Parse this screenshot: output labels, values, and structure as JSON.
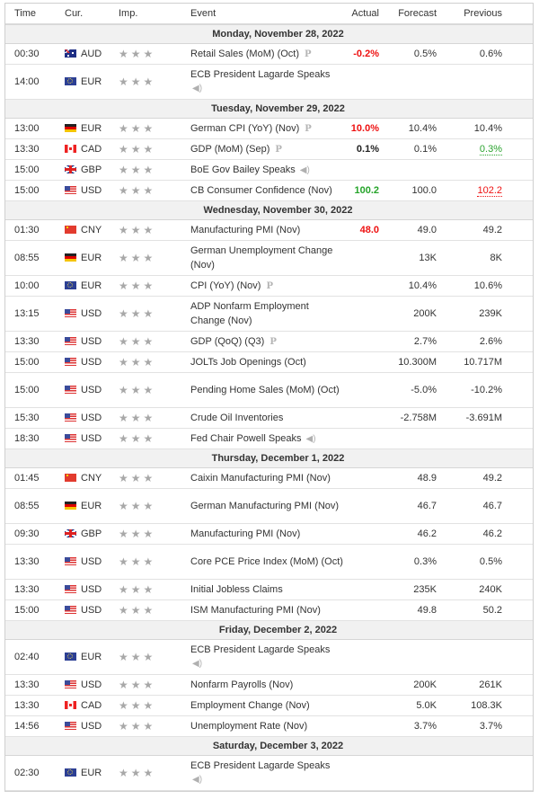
{
  "columns": {
    "time": "Time",
    "currency": "Cur.",
    "importance": "Imp.",
    "event": "Event",
    "actual": "Actual",
    "forecast": "Forecast",
    "previous": "Previous"
  },
  "importance_stars": "★★★",
  "colors": {
    "negative": "#ee1111",
    "positive": "#25a42a",
    "day_header_bg": "#f1f1f1",
    "star": "#a8a8a8"
  },
  "days": [
    {
      "label": "Monday, November 28, 2022",
      "events": [
        {
          "time": "00:30",
          "flag": "au",
          "currency": "AUD",
          "event": "Retail Sales (MoM) (Oct)",
          "marker": "P",
          "actual": "-0.2%",
          "actual_color": "red",
          "forecast": "0.5%",
          "previous": "0.6%"
        },
        {
          "time": "14:00",
          "flag": "eu",
          "currency": "EUR",
          "event": "ECB President Lagarde Speaks",
          "speaker": "speaker-icon",
          "tall": true,
          "actual": "",
          "forecast": "",
          "previous": ""
        }
      ]
    },
    {
      "label": "Tuesday, November 29, 2022",
      "events": [
        {
          "time": "13:00",
          "flag": "de",
          "currency": "EUR",
          "event": "German CPI (YoY) (Nov)",
          "marker": "P",
          "actual": "10.0%",
          "actual_color": "red",
          "forecast": "10.4%",
          "previous": "10.4%"
        },
        {
          "time": "13:30",
          "flag": "ca",
          "currency": "CAD",
          "event": "GDP (MoM) (Sep)",
          "marker": "P",
          "actual": "0.1%",
          "actual_color": "black",
          "forecast": "0.1%",
          "previous": "0.3%",
          "previous_style": "revised-up"
        },
        {
          "time": "15:00",
          "flag": "gb",
          "currency": "GBP",
          "event": "BoE Gov Bailey Speaks",
          "speaker_inline": "speaker-icon",
          "actual": "",
          "forecast": "",
          "previous": ""
        },
        {
          "time": "15:00",
          "flag": "us",
          "currency": "USD",
          "event": "CB Consumer Confidence (Nov)",
          "actual": "100.2",
          "actual_color": "green",
          "forecast": "100.0",
          "previous": "102.2",
          "previous_style": "revised-down"
        }
      ]
    },
    {
      "label": "Wednesday, November 30, 2022",
      "events": [
        {
          "time": "01:30",
          "flag": "cn",
          "currency": "CNY",
          "event": "Manufacturing PMI (Nov)",
          "actual": "48.0",
          "actual_color": "red",
          "forecast": "49.0",
          "previous": "49.2"
        },
        {
          "time": "08:55",
          "flag": "de",
          "currency": "EUR",
          "event": "German Unemployment Change (Nov)",
          "tall": true,
          "actual": "",
          "forecast": "13K",
          "previous": "8K"
        },
        {
          "time": "10:00",
          "flag": "eu",
          "currency": "EUR",
          "event": "CPI (YoY) (Nov)",
          "marker": "P",
          "actual": "",
          "forecast": "10.4%",
          "previous": "10.6%"
        },
        {
          "time": "13:15",
          "flag": "us",
          "currency": "USD",
          "event": "ADP Nonfarm Employment Change (Nov)",
          "tall": true,
          "actual": "",
          "forecast": "200K",
          "previous": "239K"
        },
        {
          "time": "13:30",
          "flag": "us",
          "currency": "USD",
          "event": "GDP (QoQ) (Q3)",
          "marker": "P",
          "actual": "",
          "forecast": "2.7%",
          "previous": "2.6%"
        },
        {
          "time": "15:00",
          "flag": "us",
          "currency": "USD",
          "event": "JOLTs Job Openings (Oct)",
          "actual": "",
          "forecast": "10.300M",
          "previous": "10.717M"
        },
        {
          "time": "15:00",
          "flag": "us",
          "currency": "USD",
          "event": "Pending Home Sales (MoM) (Oct)",
          "tall": true,
          "actual": "",
          "forecast": "-5.0%",
          "previous": "-10.2%"
        },
        {
          "time": "15:30",
          "flag": "us",
          "currency": "USD",
          "event": "Crude Oil Inventories",
          "actual": "",
          "forecast": "-2.758M",
          "previous": "-3.691M"
        },
        {
          "time": "18:30",
          "flag": "us",
          "currency": "USD",
          "event": "Fed Chair Powell Speaks",
          "speaker_inline": "speaker-icon",
          "actual": "",
          "forecast": "",
          "previous": ""
        }
      ]
    },
    {
      "label": "Thursday, December 1, 2022",
      "events": [
        {
          "time": "01:45",
          "flag": "cn",
          "currency": "CNY",
          "event": "Caixin Manufacturing PMI (Nov)",
          "actual": "",
          "forecast": "48.9",
          "previous": "49.2"
        },
        {
          "time": "08:55",
          "flag": "de",
          "currency": "EUR",
          "event": "German Manufacturing PMI (Nov)",
          "tall": true,
          "actual": "",
          "forecast": "46.7",
          "previous": "46.7"
        },
        {
          "time": "09:30",
          "flag": "gb",
          "currency": "GBP",
          "event": "Manufacturing PMI (Nov)",
          "actual": "",
          "forecast": "46.2",
          "previous": "46.2"
        },
        {
          "time": "13:30",
          "flag": "us",
          "currency": "USD",
          "event": "Core PCE Price Index (MoM) (Oct)",
          "tall": true,
          "actual": "",
          "forecast": "0.3%",
          "previous": "0.5%"
        },
        {
          "time": "13:30",
          "flag": "us",
          "currency": "USD",
          "event": "Initial Jobless Claims",
          "actual": "",
          "forecast": "235K",
          "previous": "240K"
        },
        {
          "time": "15:00",
          "flag": "us",
          "currency": "USD",
          "event": "ISM Manufacturing PMI (Nov)",
          "actual": "",
          "forecast": "49.8",
          "previous": "50.2"
        }
      ]
    },
    {
      "label": "Friday, December 2, 2022",
      "events": [
        {
          "time": "02:40",
          "flag": "eu",
          "currency": "EUR",
          "event": "ECB President Lagarde Speaks",
          "speaker": "speaker-icon",
          "tall": true,
          "actual": "",
          "forecast": "",
          "previous": ""
        },
        {
          "time": "13:30",
          "flag": "us",
          "currency": "USD",
          "event": "Nonfarm Payrolls (Nov)",
          "actual": "",
          "forecast": "200K",
          "previous": "261K"
        },
        {
          "time": "13:30",
          "flag": "ca",
          "currency": "CAD",
          "event": "Employment Change (Nov)",
          "actual": "",
          "forecast": "5.0K",
          "previous": "108.3K"
        },
        {
          "time": "14:56",
          "flag": "us",
          "currency": "USD",
          "event": "Unemployment Rate (Nov)",
          "actual": "",
          "forecast": "3.7%",
          "previous": "3.7%"
        }
      ]
    },
    {
      "label": "Saturday, December 3, 2022",
      "events": [
        {
          "time": "02:30",
          "flag": "eu",
          "currency": "EUR",
          "event": "ECB President Lagarde Speaks",
          "speaker": "speaker-icon",
          "tall": true,
          "actual": "",
          "forecast": "",
          "previous": ""
        }
      ]
    }
  ]
}
